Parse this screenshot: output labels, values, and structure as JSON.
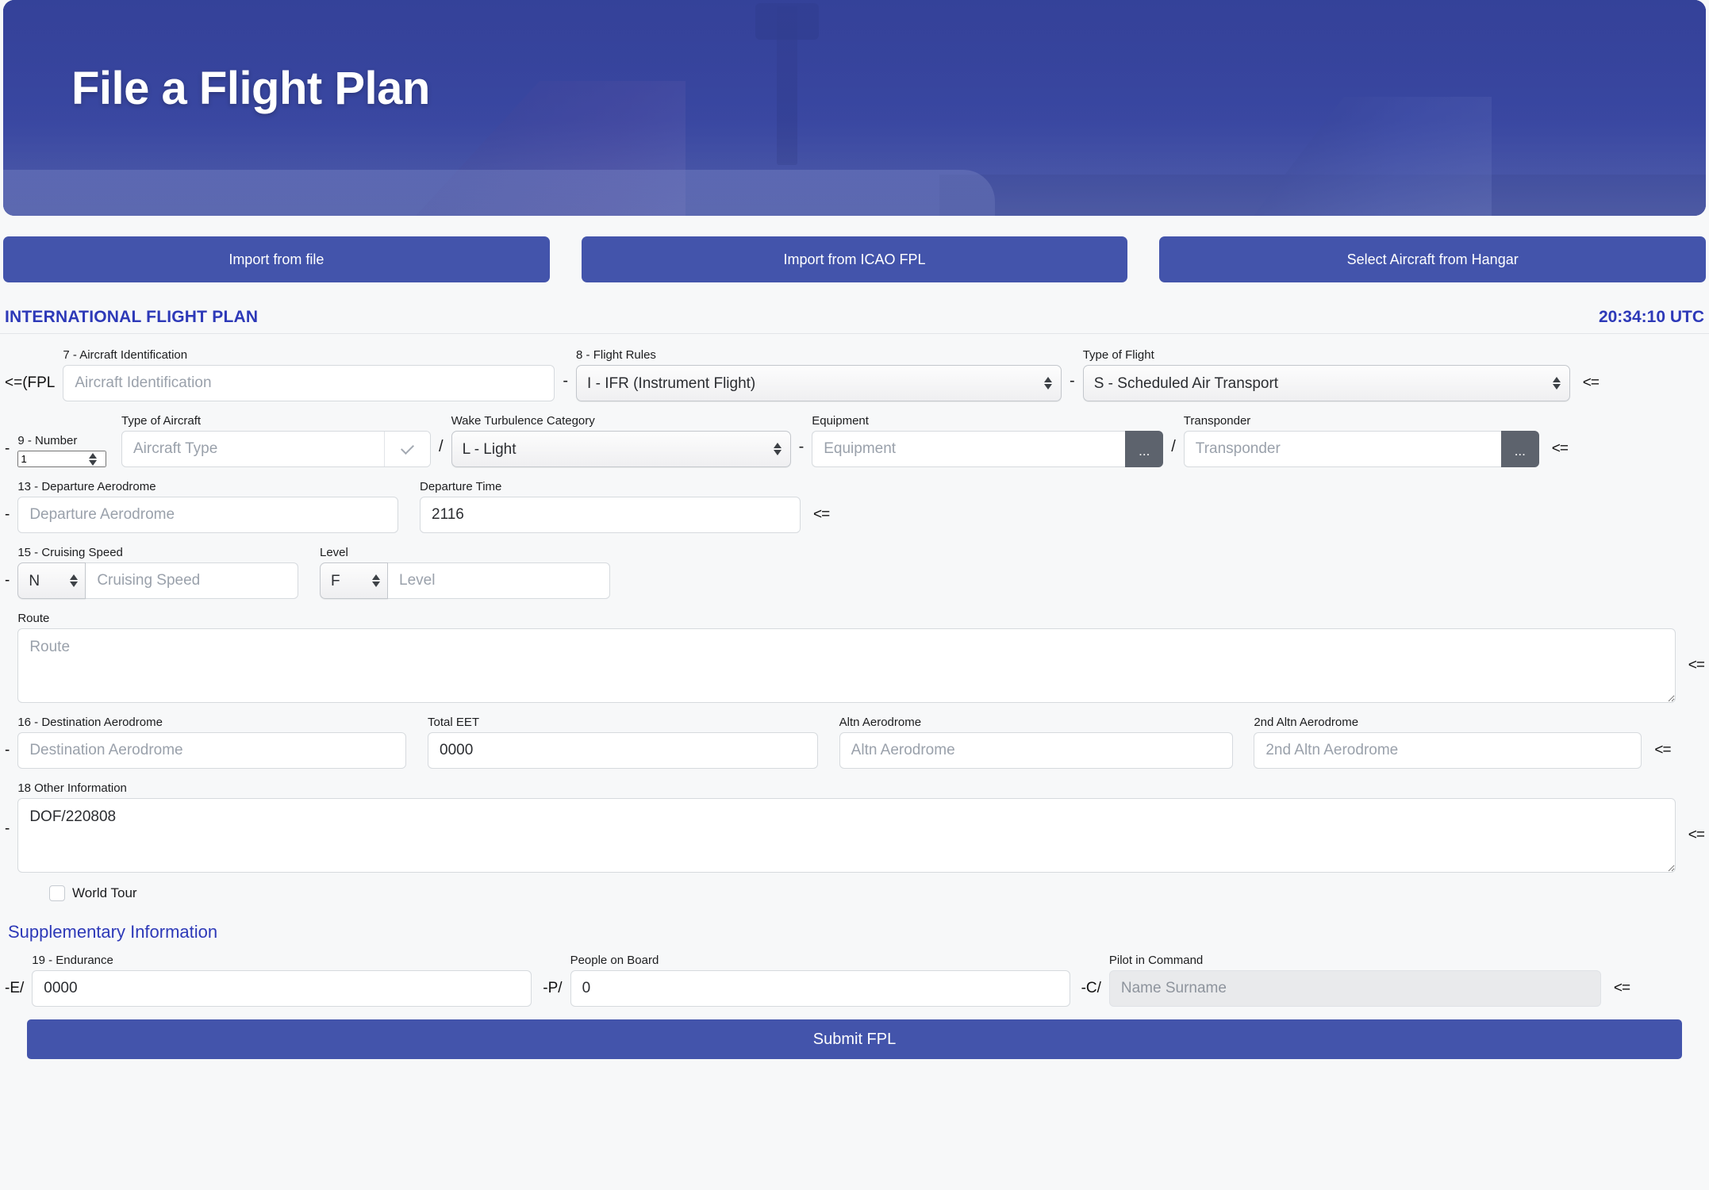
{
  "hero": {
    "title": "File a Flight Plan"
  },
  "import_buttons": [
    {
      "label": "Import from file",
      "name": "import-from-file-button"
    },
    {
      "label": "Import from ICAO FPL",
      "name": "import-from-icao-fpl-button"
    },
    {
      "label": "Select Aircraft from Hangar",
      "name": "select-aircraft-from-hangar-button"
    }
  ],
  "section": {
    "title": "INTERNATIONAL FLIGHT PLAN",
    "clock": "20:34:10 UTC"
  },
  "markers": {
    "fpl_open": "<=(FPL",
    "dash": "-",
    "slash": "/",
    "arrow_eq": "<=",
    "e_prefix": "-E/",
    "p_prefix": "-P/",
    "c_prefix": "-C/"
  },
  "fields": {
    "aircraft_identification": {
      "label": "7 - Aircraft Identification",
      "placeholder": "Aircraft Identification",
      "value": ""
    },
    "flight_rules": {
      "label": "8 - Flight Rules",
      "value": "I - IFR (Instrument Flight)"
    },
    "type_of_flight": {
      "label": "Type of Flight",
      "value": "S - Scheduled Air Transport"
    },
    "number": {
      "label": "9 - Number",
      "value": "1"
    },
    "type_of_aircraft": {
      "label": "Type of Aircraft",
      "placeholder": "Aircraft Type",
      "value": ""
    },
    "wake_turbulence": {
      "label": "Wake Turbulence Category",
      "value": "L - Light"
    },
    "equipment": {
      "label": "Equipment",
      "placeholder": "Equipment",
      "value": "",
      "button_label": "..."
    },
    "transponder": {
      "label": "Transponder",
      "placeholder": "Transponder",
      "value": "",
      "button_label": "..."
    },
    "departure_aerodrome": {
      "label": "13 - Departure Aerodrome",
      "placeholder": "Departure Aerodrome",
      "value": ""
    },
    "departure_time": {
      "label": "Departure Time",
      "placeholder": "",
      "value": "2116"
    },
    "cruising_speed": {
      "label": "15 - Cruising Speed",
      "unit": "N",
      "placeholder": "Cruising Speed",
      "value": ""
    },
    "level": {
      "label": "Level",
      "unit": "F",
      "placeholder": "Level",
      "value": ""
    },
    "route": {
      "label": "Route",
      "placeholder": "Route",
      "value": ""
    },
    "destination_aerodrome": {
      "label": "16 - Destination Aerodrome",
      "placeholder": "Destination Aerodrome",
      "value": ""
    },
    "total_eet": {
      "label": "Total EET",
      "placeholder": "",
      "value": "0000"
    },
    "altn_aerodrome": {
      "label": "Altn Aerodrome",
      "placeholder": "Altn Aerodrome",
      "value": ""
    },
    "second_altn_aerodrome": {
      "label": "2nd Altn Aerodrome",
      "placeholder": "2nd Altn Aerodrome",
      "value": ""
    },
    "other_information": {
      "label": "18 Other Information",
      "placeholder": "",
      "value": "DOF/220808"
    },
    "world_tour": {
      "label": "World Tour",
      "checked": false
    },
    "endurance": {
      "label": "19 - Endurance",
      "placeholder": "",
      "value": "0000"
    },
    "people_on_board": {
      "label": "People on Board",
      "placeholder": "",
      "value": "0"
    },
    "pilot_in_command": {
      "label": "Pilot in Command",
      "placeholder": "Name Surname",
      "value": "",
      "disabled": true
    }
  },
  "supplementary_link": "Supplementary Information",
  "submit": {
    "label": "Submit FPL"
  },
  "colors": {
    "brand_blue": "#4354ab",
    "link_blue": "#2d39b8",
    "hero_blue": "#39469c",
    "ellipsis_btn": "#5d636d"
  }
}
